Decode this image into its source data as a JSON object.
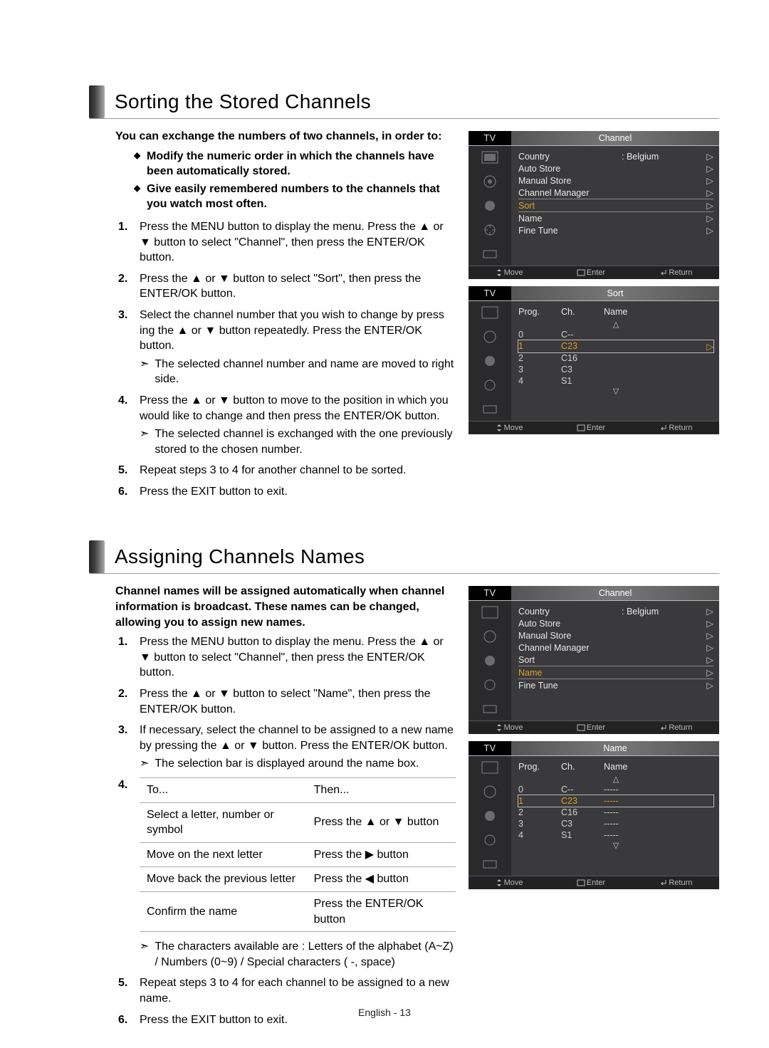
{
  "footer_lang": "English - 13",
  "section1": {
    "title": "Sorting the Stored Channels",
    "intro": "You can exchange the numbers of two channels, in order to:",
    "intro_bullets": [
      "Modify the numeric order in which the channels have been automatically stored.",
      "Give easily remembered numbers to the channels that you watch most often."
    ],
    "steps": [
      "Press the MENU button to display the menu.  Press the ▲ or ▼ button to select \"Channel\", then press the ENTER/OK button.",
      "Press the ▲ or ▼ button to select \"Sort\", then press the ENTER/OK button.",
      "Select the channel number that you wish to change by press ing the ▲ or ▼ button repeatedly. Press the ENTER/OK button.",
      "Press the ▲ or ▼ button to move to the position in which you would like to change and then press the  ENTER/OK button.",
      "Repeat steps 3 to 4 for another channel to be sorted.",
      "Press the EXIT button to exit."
    ],
    "sub3": "The selected channel number and name are moved to right side.",
    "sub4": "The selected channel is exchanged with the one previously stored to the chosen number."
  },
  "section2": {
    "title": "Assigning Channels Names",
    "intro": "Channel names will be assigned automatically when channel information is broadcast.     These names can be changed, allowing you to assign new names.",
    "steps": [
      "Press the MENU button to display the menu. Press the ▲ or ▼ button to select \"Channel\", then press the ENTER/OK button.",
      "Press the ▲ or ▼ button to select \"Name\", then press the ENTER/OK button.",
      "If necessary, select the channel to be assigned to a new name by pressing the ▲ or ▼ button. Press the ENTER/OK button.",
      "",
      "Repeat steps 3 to 4 for each channel to be assigned to a new name.",
      "Press the EXIT button to exit."
    ],
    "sub3": "The selection bar is displayed around the name box.",
    "table_head": [
      "To...",
      "Then..."
    ],
    "table_rows": [
      [
        "Select a letter, number or symbol",
        "Press the ▲ or ▼ button"
      ],
      [
        "Move on the next letter",
        "Press the ▶ button"
      ],
      [
        "Move back the previous letter",
        "Press the ◀ button"
      ],
      [
        "Confirm the name",
        "Press the ENTER/OK button"
      ]
    ],
    "char_note": "The characters available are : Letters of the alphabet (A~Z) / Numbers (0~9) / Special characters ( -, space)"
  },
  "osd": {
    "tv_label": "TV",
    "channel_title": "Channel",
    "sort_title": "Sort",
    "name_title": "Name",
    "menu": {
      "country_label": "Country",
      "country_value": ": Belgium",
      "auto_store": "Auto Store",
      "manual_store": "Manual Store",
      "channel_manager": "Channel Manager",
      "sort": "Sort",
      "name": "Name",
      "fine_tune": "Fine Tune"
    },
    "footer": {
      "move": "Move",
      "enter": "Enter",
      "return": "Return"
    },
    "sort_cols": {
      "prog": "Prog.",
      "ch": "Ch.",
      "name": "Name"
    },
    "sort_rows": [
      {
        "prog": "0",
        "ch": "C--",
        "name": ""
      },
      {
        "prog": "1",
        "ch": "C23",
        "name": ""
      },
      {
        "prog": "2",
        "ch": "C16",
        "name": ""
      },
      {
        "prog": "3",
        "ch": "C3",
        "name": ""
      },
      {
        "prog": "4",
        "ch": "S1",
        "name": ""
      }
    ],
    "name_rows": [
      {
        "prog": "0",
        "ch": "C--",
        "name": "-----"
      },
      {
        "prog": "1",
        "ch": "C23",
        "name": "-----"
      },
      {
        "prog": "2",
        "ch": "C16",
        "name": "-----"
      },
      {
        "prog": "3",
        "ch": "C3",
        "name": "-----"
      },
      {
        "prog": "4",
        "ch": "S1",
        "name": "-----"
      }
    ]
  }
}
